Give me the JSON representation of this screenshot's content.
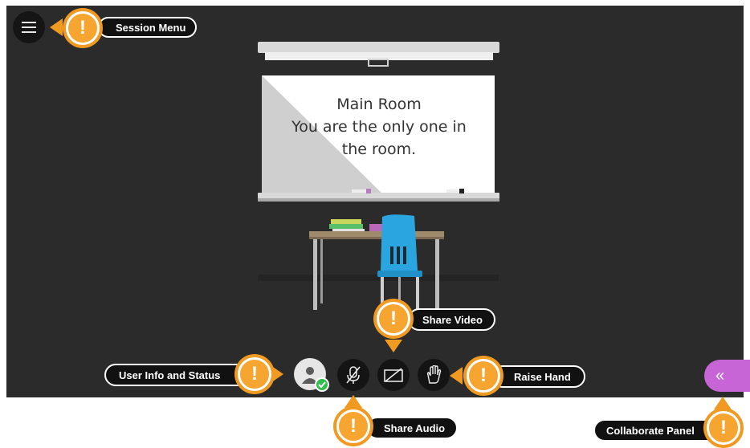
{
  "room": {
    "name": "Main Room",
    "message_line1": "You are the only one in",
    "message_line2": "the room."
  },
  "callouts": {
    "session_menu": "Session Menu",
    "user_info": "User Info and Status",
    "share_audio": "Share Audio",
    "share_video": "Share Video",
    "raise_hand": "Raise Hand",
    "collaborate_panel": "Collaborate Panel",
    "mark": "!"
  },
  "icons": {
    "menu": "hamburger-icon",
    "avatar": "user-avatar-icon",
    "status": "checkmark-icon",
    "audio": "microphone-muted-icon",
    "video": "camera-off-icon",
    "hand": "raised-hand-icon",
    "collab": "double-chevron-left-icon",
    "collab_glyph": "«"
  },
  "colors": {
    "stage": "#2b2b2b",
    "callout_orange": "#f7a531",
    "collab_purple": "#c765d6",
    "status_green": "#2fbf4a"
  }
}
